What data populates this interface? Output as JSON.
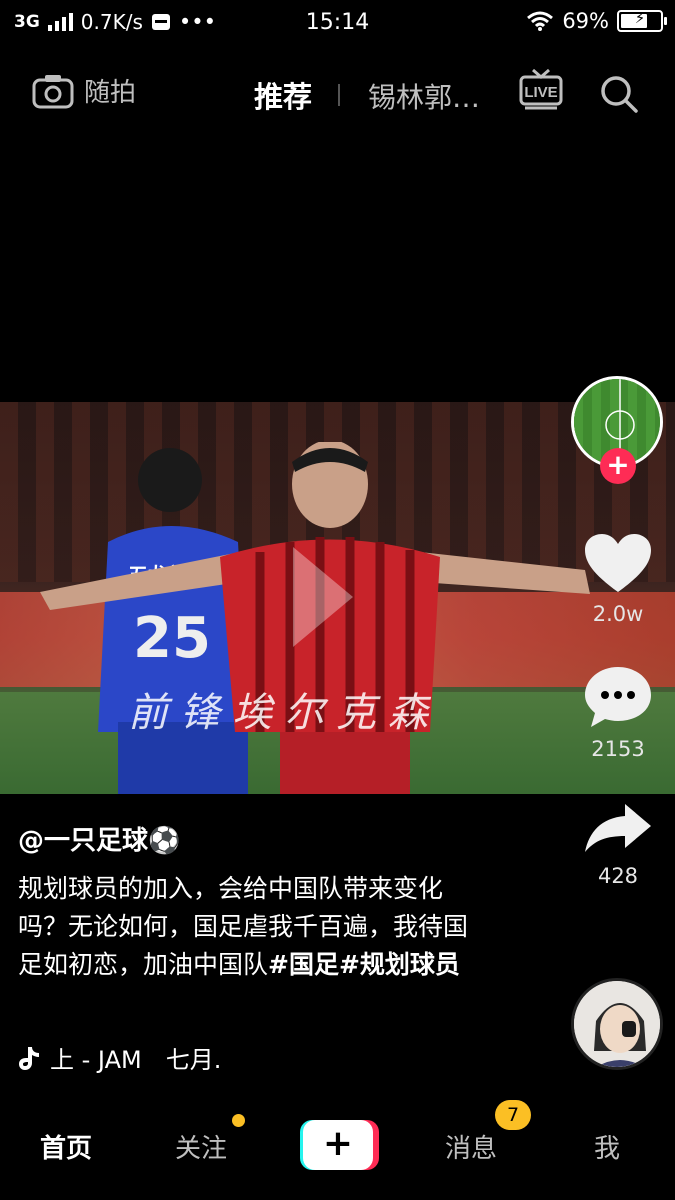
{
  "status_bar": {
    "network": "3G",
    "speed": "0.7K/s",
    "more": "•••",
    "time": "15:14",
    "battery": "69%",
    "battery_level": 0.69
  },
  "top_nav": {
    "camera_label": "随拍",
    "tab_recommend": "推荐",
    "tab_city": "锡林郭…",
    "live_label": "LIVE"
  },
  "video": {
    "caption": "前锋埃尔克森"
  },
  "actions": {
    "likes": "2.0w",
    "comments": "2153",
    "shares": "428"
  },
  "post": {
    "author": "@一只足球⚽",
    "description": "规划球员的加入，会给中国队带来变化吗？无论如何，国足虐我千百遍，我待国足如初恋，加油中国队",
    "hashtag": "#国足#规划球员",
    "music": "上 - JAM　七月."
  },
  "bottom_nav": {
    "home": "首页",
    "follow": "关注",
    "create": "+",
    "messages": "消息",
    "messages_badge": "7",
    "me": "我"
  },
  "colors": {
    "background": "#000000",
    "accent_red": "#fe2c55",
    "accent_cyan": "#25f4ee",
    "badge_yellow": "#fbbf24"
  }
}
